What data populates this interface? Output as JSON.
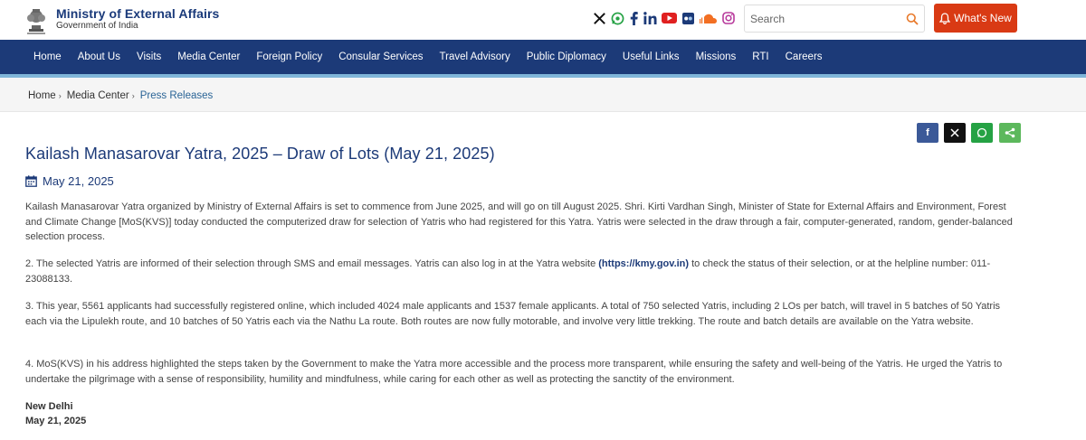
{
  "header": {
    "title": "Ministry of External Affairs",
    "subtitle": "Government of India",
    "search_placeholder": "Search",
    "whats_new_label": "What's New",
    "social_icons": [
      "x-icon",
      "whatsapp-icon",
      "facebook-icon",
      "linkedin-icon",
      "youtube-icon",
      "flickr-icon",
      "soundcloud-icon",
      "instagram-icon"
    ],
    "colors": {
      "brand_blue": "#1c3a78",
      "whats_new_red": "#d93a14"
    }
  },
  "nav": {
    "items": [
      "Home",
      "About Us",
      "Visits",
      "Media Center",
      "Foreign Policy",
      "Consular Services",
      "Travel Advisory",
      "Public Diplomacy",
      "Useful Links",
      "Missions",
      "RTI",
      "Careers"
    ]
  },
  "breadcrumb": {
    "items": [
      "Home",
      "Media Center",
      "Press Releases"
    ],
    "separator": "›"
  },
  "share": {
    "buttons": [
      "facebook",
      "x",
      "whatsapp",
      "share"
    ],
    "facebook_glyph": "f",
    "x_glyph": "𝕏"
  },
  "article": {
    "title": "Kailash Manasarovar Yatra, 2025 – Draw of Lots (May 21, 2025)",
    "date": "May 21, 2025",
    "p1": "Kailash Manasarovar Yatra organized by Ministry of External Affairs is set to commence from June 2025, and will go on till August 2025. Shri. Kirti Vardhan Singh, Minister of State for External Affairs and Environment, Forest and Climate Change [MoS(KVS)] today conducted the computerized draw for selection of Yatris who had registered for this Yatra. Yatris were selected in the draw through a fair, computer-generated, random, gender-balanced selection process.",
    "p2_before": "2. The selected Yatris are informed of their selection through SMS and email messages. Yatris can also log in at the Yatra website ",
    "p2_link": "(https://kmy.gov.in)",
    "p2_after": " to check the status of their selection, or at the helpline number: 011-23088133.",
    "p3": "3. This year, 5561 applicants had successfully registered online, which included 4024 male applicants and 1537 female applicants. A total of 750 selected Yatris, including 2 LOs per batch, will travel in 5 batches of 50 Yatris each via the Lipulekh route, and 10 batches of 50 Yatris each via the Nathu La route. Both routes are now fully motorable, and involve very little trekking. The route and batch details are available on the Yatra website.",
    "p4": "4. MoS(KVS) in his address highlighted the steps taken by the Government to make the Yatra more accessible and the process more transparent, while ensuring the safety and well-being of the Yatris. He urged the Yatris to undertake the pilgrimage with a sense of responsibility, humility and mindfulness, while caring for each other as well as protecting the sanctity of the environment.",
    "place": "New Delhi",
    "sign_date": "May 21, 2025"
  }
}
